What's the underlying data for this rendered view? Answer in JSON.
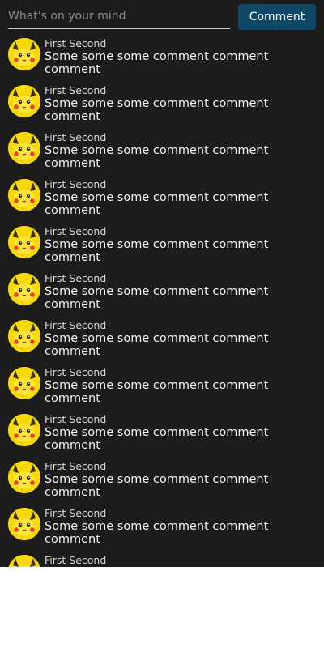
{
  "composer": {
    "placeholder": "What's on your mind",
    "value": "",
    "submit_label": "Comment"
  },
  "colors": {
    "background": "#1c1c1c",
    "button": "#0f4766",
    "avatar": "#f5d90a"
  },
  "avatar_icon": "pikachu-face-icon",
  "comments": [
    {
      "author": "First Second",
      "text": "Some some some comment comment comment"
    },
    {
      "author": "First Second",
      "text": "Some some some comment comment comment"
    },
    {
      "author": "First Second",
      "text": "Some some some comment comment comment"
    },
    {
      "author": "First Second",
      "text": "Some some some comment comment comment"
    },
    {
      "author": "First Second",
      "text": "Some some some comment comment comment"
    },
    {
      "author": "First Second",
      "text": "Some some some comment comment comment"
    },
    {
      "author": "First Second",
      "text": "Some some some comment comment comment"
    },
    {
      "author": "First Second",
      "text": "Some some some comment comment comment"
    },
    {
      "author": "First Second",
      "text": "Some some some comment comment comment"
    },
    {
      "author": "First Second",
      "text": "Some some some comment comment comment"
    },
    {
      "author": "First Second",
      "text": "Some some some comment comment comment"
    },
    {
      "author": "First Second",
      "text": ""
    }
  ]
}
